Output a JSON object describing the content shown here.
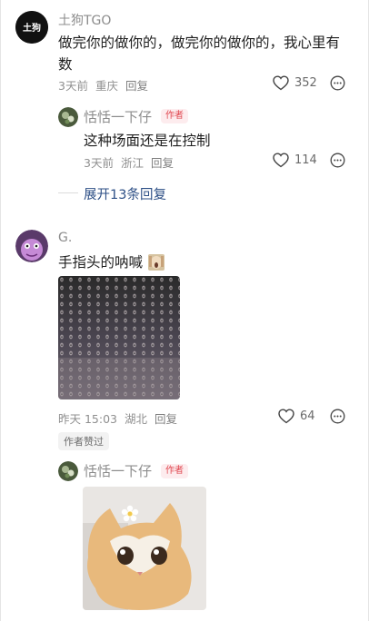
{
  "comments": [
    {
      "author": "土狗TGO",
      "avatar_text": "土狗",
      "text": "做完你的做你的，做完你的做你的，我心里有数",
      "time": "3天前",
      "location": "重庆",
      "reply_label": "回复",
      "likes": "352",
      "replies": [
        {
          "author": "恬恬一下仔",
          "author_tag": "作者",
          "text": "这种场面还是在控制",
          "time": "3天前",
          "location": "浙江",
          "reply_label": "回复",
          "likes": "114"
        }
      ],
      "expand_label": "展开13条回复"
    },
    {
      "author": "G.",
      "text": "手指头的呐喊",
      "time": "昨天 15:03",
      "location": "湖北",
      "reply_label": "回复",
      "likes": "64",
      "liked_badge": "作者赞过",
      "replies": [
        {
          "author": "恬恬一下仔",
          "author_tag": "作者"
        }
      ]
    }
  ],
  "colors": {
    "author_tag": "#e0464f",
    "author_tag_bg": "#fdecee",
    "expand_link": "#2d4f86",
    "meta": "#8f8f8f"
  }
}
